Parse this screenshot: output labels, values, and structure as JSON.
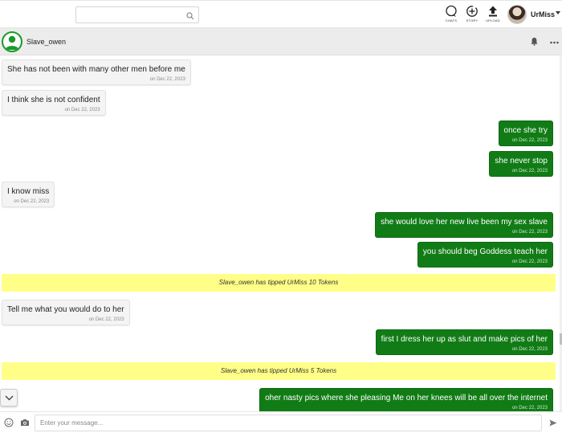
{
  "topbar": {
    "search": {
      "placeholder": ""
    },
    "nav": [
      {
        "label": "CHATS"
      },
      {
        "label": "STORY"
      },
      {
        "label": "UPLOAD"
      }
    ],
    "username": "UrMiss"
  },
  "chat": {
    "contact_name": "Slave_owen",
    "messages": [
      {
        "dir": "in",
        "text": "She has not been with many other men before me",
        "time": "on Dec 22, 2023"
      },
      {
        "dir": "in",
        "text": "I think she is not confident",
        "time": "on Dec 22, 2023"
      },
      {
        "dir": "out",
        "text": "once she try",
        "time": "on Dec 22, 2023"
      },
      {
        "dir": "out",
        "text": "she never stop",
        "time": "on Dec 22, 2023"
      },
      {
        "dir": "in",
        "text": "I know miss",
        "time": "on Dec 22, 2023"
      },
      {
        "dir": "out",
        "text": "she would love her new live been my sex slave",
        "time": "on Dec 22, 2023"
      },
      {
        "dir": "out",
        "text": "you should beg Goddess teach her",
        "time": "on Dec 22, 2023"
      },
      {
        "dir": "tip",
        "text": "Slave_owen has tipped UrMiss 10 Tokens"
      },
      {
        "dir": "in",
        "text": "Tell me what you would do to her",
        "time": "on Dec 22, 2023"
      },
      {
        "dir": "out",
        "text": "first I dress her up as slut and make pics of her",
        "time": "on Dec 22, 2023"
      },
      {
        "dir": "tip",
        "text": "Slave_owen has tipped UrMiss 5 Tokens"
      },
      {
        "dir": "out",
        "text": "oher nasty pics where she pleasing Me on her knees will be all over the internet",
        "time": "on Dec 22, 2023"
      }
    ]
  },
  "composer": {
    "placeholder": "Enter your message..."
  },
  "colors": {
    "outgoing_bubble": "#117c16",
    "tip_banner": "#ffff88",
    "avatar_ring": "#1a9a2a"
  }
}
